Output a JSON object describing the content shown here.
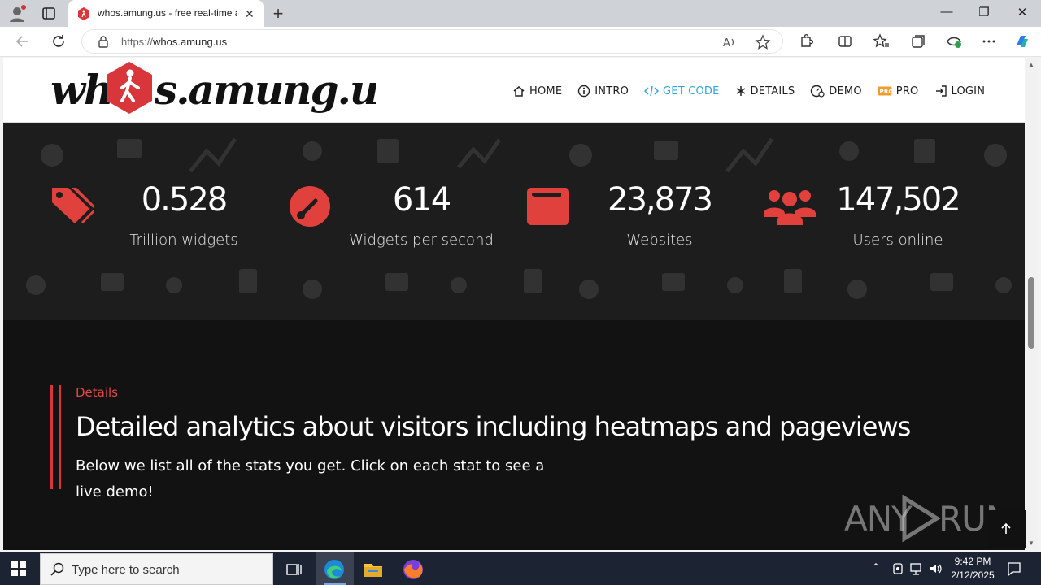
{
  "browser": {
    "tab_title": "whos.amung.us - free real-time analytics",
    "url_proto": "https://",
    "url_host": "whos.amung.us"
  },
  "site": {
    "logo_text": "wh  s.amung.us",
    "menu": [
      {
        "label": "HOME",
        "icon": "home-icon"
      },
      {
        "label": "INTRO",
        "icon": "info-icon"
      },
      {
        "label": "GET CODE",
        "icon": "code-icon",
        "active": true
      },
      {
        "label": "DETAILS",
        "icon": "asterisk-icon"
      },
      {
        "label": "DEMO",
        "icon": "dashboard-icon"
      },
      {
        "label": "PRO",
        "icon": "pro-badge-icon"
      },
      {
        "label": "LOGIN",
        "icon": "login-icon"
      }
    ],
    "accent_color": "#d8363a",
    "active_menu_color": "#2fa7d9"
  },
  "stats": [
    {
      "value": "0.528",
      "label": "Trillion widgets",
      "icon": "tags-icon"
    },
    {
      "value": "614",
      "label": "Widgets per second",
      "icon": "gauge-icon"
    },
    {
      "value": "23,873",
      "label": "Websites",
      "icon": "browser-window-icon"
    },
    {
      "value": "147,502",
      "label": "Users online",
      "icon": "users-icon"
    }
  ],
  "details": {
    "kicker": "Details",
    "headline": "Detailed analytics about visitors including heatmaps and pageviews",
    "lede": "Below we list all of the stats you get. Click on each stat to see a live demo!"
  },
  "watermark": "ANY RUN",
  "taskbar": {
    "search_placeholder": "Type here to search",
    "time": "9:42 PM",
    "date": "2/12/2025"
  }
}
